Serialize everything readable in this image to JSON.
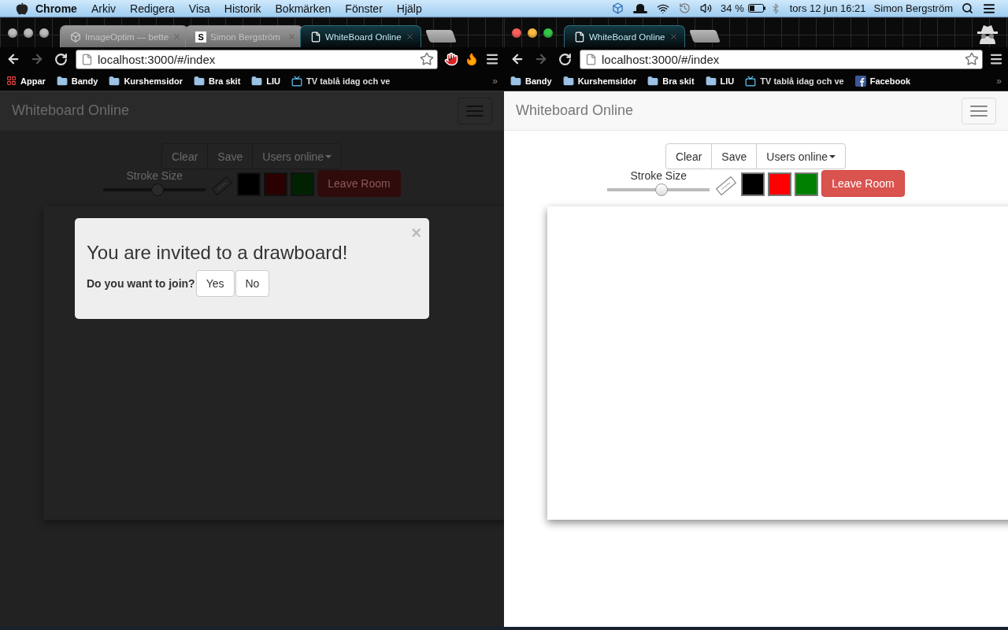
{
  "menu_bar": {
    "app": "Chrome",
    "menus": [
      "Arkiv",
      "Redigera",
      "Visa",
      "Historik",
      "Bokmärken",
      "Fönster",
      "Hjälp"
    ],
    "battery": "34 %",
    "clock": "tors 12 jun  16:21",
    "user": "Simon Bergström"
  },
  "windows": [
    {
      "focused": false,
      "tabs": [
        {
          "title": "ImageOptim — bette",
          "selected": false,
          "kind": "app"
        },
        {
          "title": "Simon Bergström",
          "selected": false,
          "kind": "letter",
          "badge": "S"
        },
        {
          "title": "WhiteBoard Online",
          "selected": true,
          "kind": "page"
        }
      ],
      "address": "localhost:3000/#/index",
      "extension_icons": true,
      "bookmarks": [
        {
          "label": "Appar",
          "kind": "apps"
        },
        {
          "label": "Bandy",
          "kind": "folder"
        },
        {
          "label": "Kurshemsidor",
          "kind": "folder"
        },
        {
          "label": "Bra skit",
          "kind": "folder"
        },
        {
          "label": "LIU",
          "kind": "folder"
        },
        {
          "label": "TV tablå idag och ve",
          "kind": "tv"
        }
      ],
      "bookmarks_overflow": "»",
      "page": {
        "brand": "Whiteboard Online",
        "actions": [
          "Clear",
          "Save",
          "Users online"
        ],
        "stroke_label": "Stroke Size",
        "stroke": {
          "level": 0.53
        },
        "swatches": [
          {
            "color": "#000000"
          },
          {
            "color": "#2a0000"
          },
          {
            "color": "#002200"
          }
        ],
        "leave": "Leave Room"
      },
      "dialog": {
        "close": "×",
        "title": "You are invited to a drawboard!",
        "question": "Do you want to join?",
        "buttons": [
          "Yes",
          "No"
        ]
      }
    },
    {
      "focused": true,
      "tabs": [
        {
          "title": "WhiteBoard Online",
          "selected": true,
          "kind": "page"
        }
      ],
      "address": "localhost:3000/#/index",
      "bookmarks": [
        {
          "label": "Bandy",
          "kind": "folder"
        },
        {
          "label": "Kurshemsidor",
          "kind": "folder"
        },
        {
          "label": "Bra skit",
          "kind": "folder"
        },
        {
          "label": "LIU",
          "kind": "folder"
        },
        {
          "label": "TV tablå idag och ve",
          "kind": "tv"
        },
        {
          "label": "Facebook",
          "kind": "facebook"
        }
      ],
      "bookmarks_overflow": "»",
      "page": {
        "brand": "Whiteboard Online",
        "actions": [
          "Clear",
          "Save",
          "Users online"
        ],
        "stroke_label": "Stroke Size",
        "stroke": {
          "level": 0.53
        },
        "swatches": [
          {
            "color": "#000000"
          },
          {
            "color": "#ff0000"
          },
          {
            "color": "#008000"
          }
        ],
        "leave": "Leave Room"
      }
    }
  ]
}
